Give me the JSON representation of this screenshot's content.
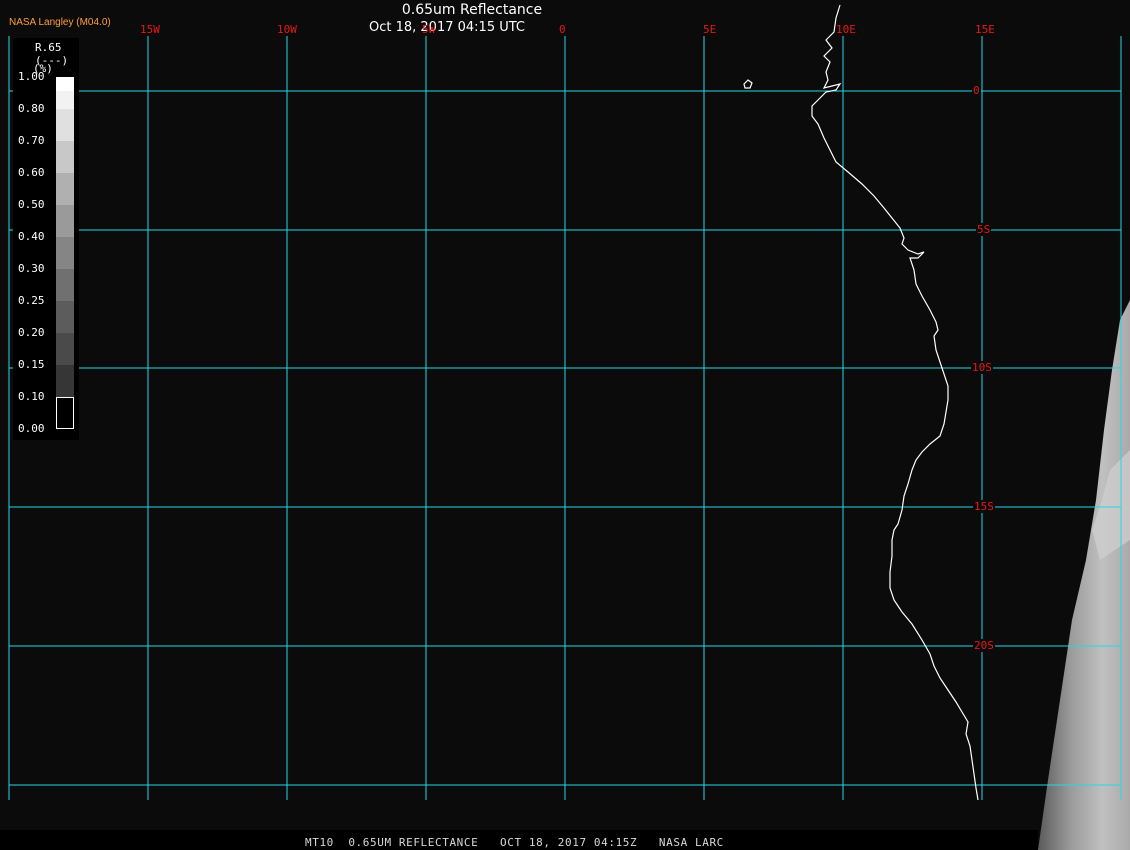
{
  "window": {
    "title": "0.65um Reflectance",
    "subtitle": "Oct 18, 2017 04:15 UTC",
    "organization": "NASA Langley (M04.0)",
    "footer": "MT10  0.65UM REFLECTANCE   OCT 18, 2017 04:15Z   NASA LARC"
  },
  "map": {
    "longitude_labels": [
      "15W",
      "10W",
      "5W",
      "0",
      "5E",
      "10E",
      "15E"
    ],
    "latitude_labels": [
      "0",
      "5S",
      "10S",
      "15S",
      "20S"
    ],
    "gridline_color": "#28d6e6",
    "label_color": "#e81818",
    "coastline_color": "#ffffff",
    "background_color": "#0b0b0b",
    "channel_name": "0.65um Reflectance"
  },
  "colorbar": {
    "title_line1": "R.65",
    "title_line2": "(---)",
    "title_line3": "(%)",
    "ticks": [
      "1.00",
      "0.80",
      "0.70",
      "0.60",
      "0.50",
      "0.40",
      "0.30",
      "0.25",
      "0.20",
      "0.15",
      "0.10",
      "0.00"
    ],
    "swatch_colors": [
      "#ffffff",
      "#e4e4e4",
      "#cecece",
      "#b8b8b8",
      "#a4a4a4",
      "#909090",
      "#7c7c7c",
      "#686868",
      "#565656",
      "#444444",
      "#2c2c2c",
      "#000000"
    ]
  }
}
